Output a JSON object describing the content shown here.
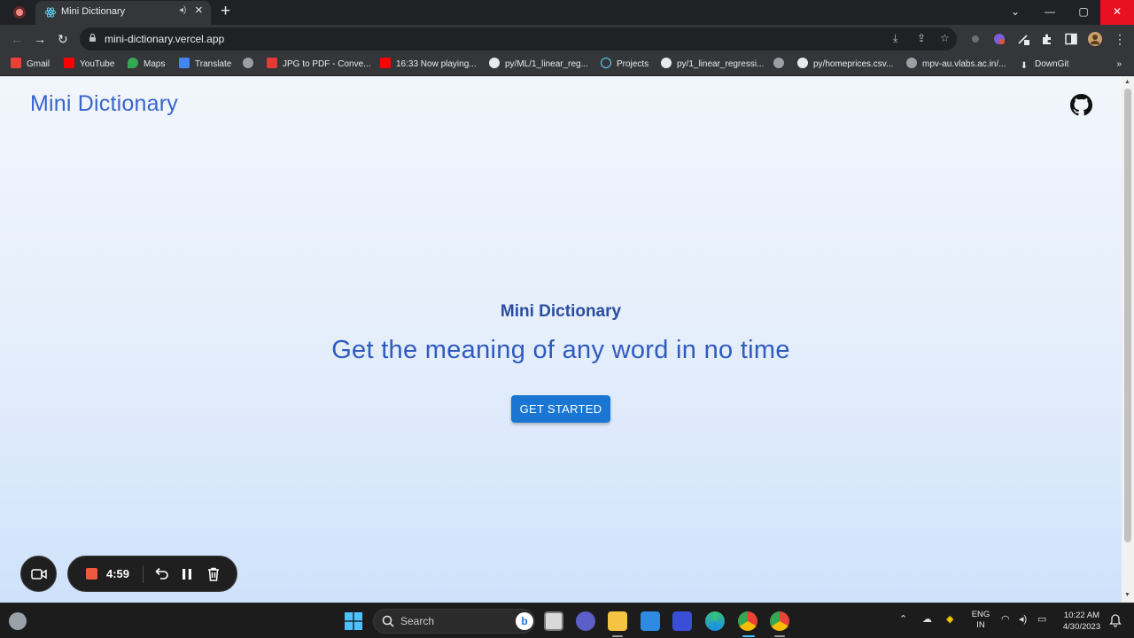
{
  "browser": {
    "tab": {
      "title": "Mini Dictionary",
      "audio_icon": "speaker-icon",
      "close_icon": "close-icon"
    },
    "new_tab_icon": "plus-icon",
    "window_controls": {
      "minimize": "—",
      "maximize": "▢",
      "close": "✕"
    },
    "nav": {
      "back": "←",
      "forward": "→",
      "reload": "↻"
    },
    "omnibox": {
      "url": "mini-dictionary.vercel.app"
    },
    "bookmarks": [
      {
        "label": "Gmail",
        "icon": "gmail-icon",
        "color": "#ea4335"
      },
      {
        "label": "YouTube",
        "icon": "youtube-icon",
        "color": "#ff0000"
      },
      {
        "label": "Maps",
        "icon": "maps-icon",
        "color": "#34a853"
      },
      {
        "label": "Translate",
        "icon": "translate-icon",
        "color": "#4285f4"
      },
      {
        "label": "",
        "icon": "globe-icon",
        "color": "#9aa0a6"
      },
      {
        "label": "JPG to PDF - Conve...",
        "icon": "pdf-icon",
        "color": "#e53935"
      },
      {
        "label": "16:33 Now playing...",
        "icon": "youtube-icon",
        "color": "#ff0000"
      },
      {
        "label": "py/ML/1_linear_reg...",
        "icon": "github-icon",
        "color": "#e8eaed"
      },
      {
        "label": "Projects",
        "icon": "react-icon",
        "color": "#61dafb"
      },
      {
        "label": "py/1_linear_regressi...",
        "icon": "github-icon",
        "color": "#e8eaed"
      },
      {
        "label": "",
        "icon": "globe-icon",
        "color": "#9aa0a6"
      },
      {
        "label": "py/homeprices.csv...",
        "icon": "github-icon",
        "color": "#e8eaed"
      },
      {
        "label": "mpv-au.vlabs.ac.in/...",
        "icon": "globe-icon",
        "color": "#9aa0a6"
      },
      {
        "label": "DownGit",
        "icon": "download-icon",
        "color": "#e8eaed"
      }
    ],
    "bookmarks_more": "»"
  },
  "page": {
    "logo": "Mini Dictionary",
    "github_icon": "github-icon",
    "hero": {
      "subtitle": "Mini Dictionary",
      "title": "Get the meaning of any word in no time",
      "cta_label": "GET STARTED"
    },
    "colors": {
      "accent": "#1976d2",
      "heading": "#2f5bbf"
    }
  },
  "recorder": {
    "time": "4:59",
    "camera_icon": "camera-icon",
    "stop_icon": "stop-icon",
    "undo_icon": "undo-icon",
    "pause_icon": "pause-icon",
    "delete_icon": "trash-icon"
  },
  "taskbar": {
    "search_label": "Search",
    "language": {
      "line1": "ENG",
      "line2": "IN"
    },
    "clock": {
      "time": "10:22 AM",
      "date": "4/30/2023"
    },
    "apps": [
      "windows-start-icon",
      "search-icon",
      "bing-icon",
      "file-explorer-icon",
      "teams-icon",
      "folder-icon",
      "mail-icon",
      "vscode-icon",
      "edge-icon",
      "chrome-icon",
      "chrome-icon"
    ]
  }
}
